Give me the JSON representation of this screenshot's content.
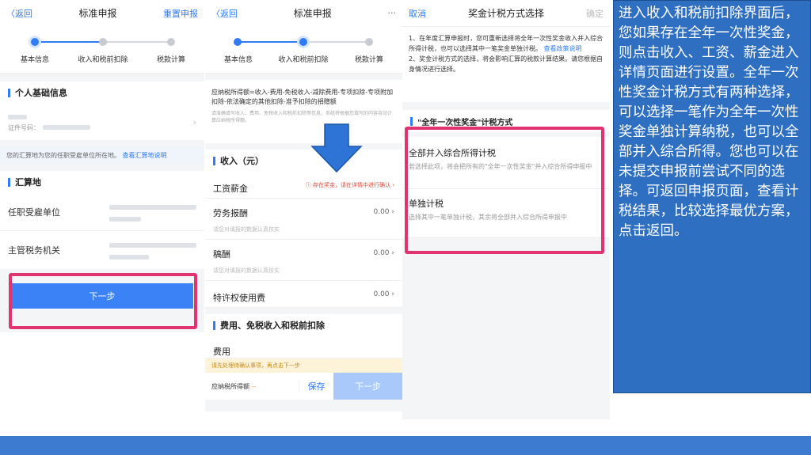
{
  "phone1": {
    "nav": {
      "back": "〈返回",
      "title": "标准申报",
      "reset": "重置申报"
    },
    "steps": [
      "基本信息",
      "收入和税前扣除",
      "税款计算"
    ],
    "personal": {
      "title": "个人基础信息",
      "id_label": "证件号码："
    },
    "note": {
      "text": "您的汇算地为您的任职受雇单位所在地。",
      "link": "查看汇算地说明"
    },
    "settlement": {
      "title": "汇算地",
      "employer_label": "任职受雇单位",
      "tax_office_label": "主管税务机关"
    },
    "next_button": "下一步"
  },
  "phone2": {
    "nav": {
      "back": "〈返回",
      "title": "标准申报",
      "more": "···"
    },
    "steps": [
      "基本信息",
      "收入和税前扣除",
      "税款计算"
    ],
    "formula": "应纳税所得额=收入-费用-免税收入-减除费用-专项扣除-专项附加扣除-依法确定的其他扣除-准予扣除的捐赠额",
    "formula_hint": "请准确填写收入、费用、免税收入和税前扣除等信息，系统将根据您填写的内容自动计算应纳税所得额。",
    "income": {
      "title": "收入（元）",
      "items": [
        {
          "name": "工资薪金",
          "value": "存在奖金，请在详情中进行确认",
          "hint": ""
        },
        {
          "name": "劳务报酬",
          "value": "0.00",
          "hint": "请您对填报的数据认真核实"
        },
        {
          "name": "稿酬",
          "value": "0.00",
          "hint": "请您对填报的数据认真核实"
        },
        {
          "name": "特许权使用费",
          "value": "0.00",
          "hint": ""
        }
      ]
    },
    "deduction": {
      "title": "费用、免税收入和税前扣除",
      "fee_label": "费用"
    },
    "warning": "请先处理待确认事项，再点击下一步",
    "bottom": {
      "taxable_label": "应纳税所得额",
      "taxable_value": "--",
      "save": "保存",
      "next": "下一步"
    }
  },
  "phone3": {
    "nav": {
      "cancel": "取消",
      "title": "奖金计税方式选择",
      "confirm": "确定"
    },
    "intro": "1、在年度汇算申报时，您可重新选择将全年一次性奖金收入并入综合所得计税，也可以选择其中一笔奖金单独计税。",
    "policy_link": "查看政策说明",
    "intro2": "2、奖金计税方式的选择，将会影响汇算的税款计算结果。请您根据自身情况进行选择。",
    "section_title": "\"全年一次性奖金\"计税方式",
    "options": [
      {
        "title": "全部并入综合所得计税",
        "desc": "若选择此项，将会把所有的\"全年一次性奖金\"并入综合所得申报中"
      },
      {
        "title": "单独计税",
        "desc": "选择其中一笔单独计税，其余将全部并入综合所得申报中"
      }
    ]
  },
  "description": "进入收入和税前扣除界面后，您如果存在全年一次性奖金，则点击收入、工资、薪金进入详情页面进行设置。全年一次性奖金计税方式有两种选择，可以选择一笔作为全年一次性奖金单独计算纳税，也可以全部并入综合所得。您也可以在未提交申报前尝试不同的选择。可返回申报页面，查看计税结果，比较选择最优方案，点击返回。",
  "colors": {
    "accent": "#2f7cf6",
    "highlight": "#e0336f",
    "panel": "#2e6fc1"
  }
}
